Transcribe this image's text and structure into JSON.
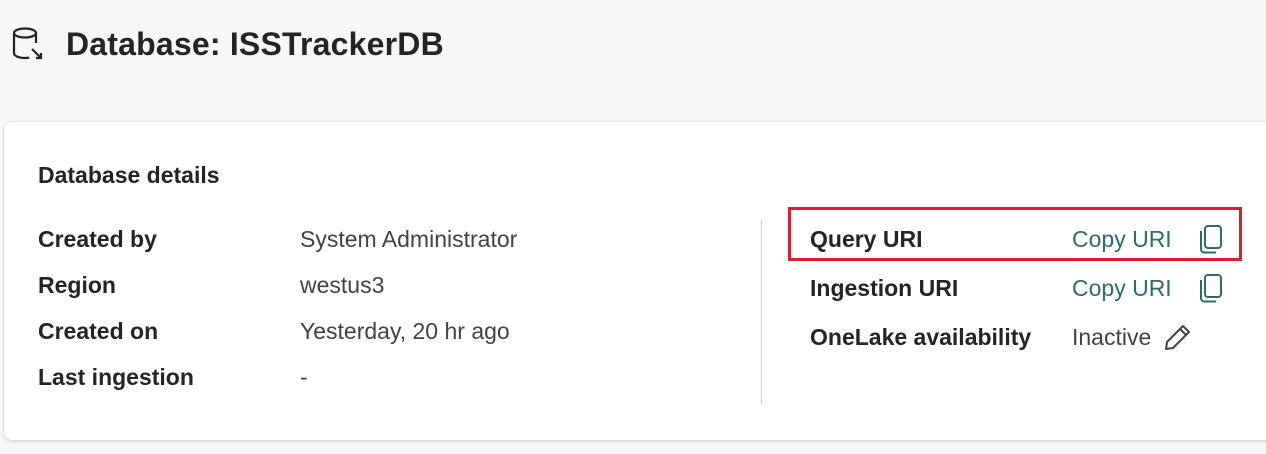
{
  "header": {
    "icon": "database-icon",
    "title": "Database: ISSTrackerDB"
  },
  "details": {
    "section_title": "Database details",
    "left_rows": [
      {
        "label": "Created by",
        "value": "System Administrator"
      },
      {
        "label": "Region",
        "value": "westus3"
      },
      {
        "label": "Created on",
        "value": "Yesterday, 20 hr ago"
      },
      {
        "label": "Last ingestion",
        "value": "-"
      }
    ],
    "right_rows": [
      {
        "label": "Query URI",
        "action": "Copy URI",
        "icon": "copy-icon",
        "highlighted": true
      },
      {
        "label": "Ingestion URI",
        "action": "Copy URI",
        "icon": "copy-icon"
      },
      {
        "label": "OneLake availability",
        "value": "Inactive",
        "icon": "pencil-icon"
      }
    ]
  },
  "colors": {
    "link": "#2b6e63",
    "highlight_border": "#d62032",
    "page_bg": "#f7f7f7",
    "card_bg": "#ffffff"
  }
}
